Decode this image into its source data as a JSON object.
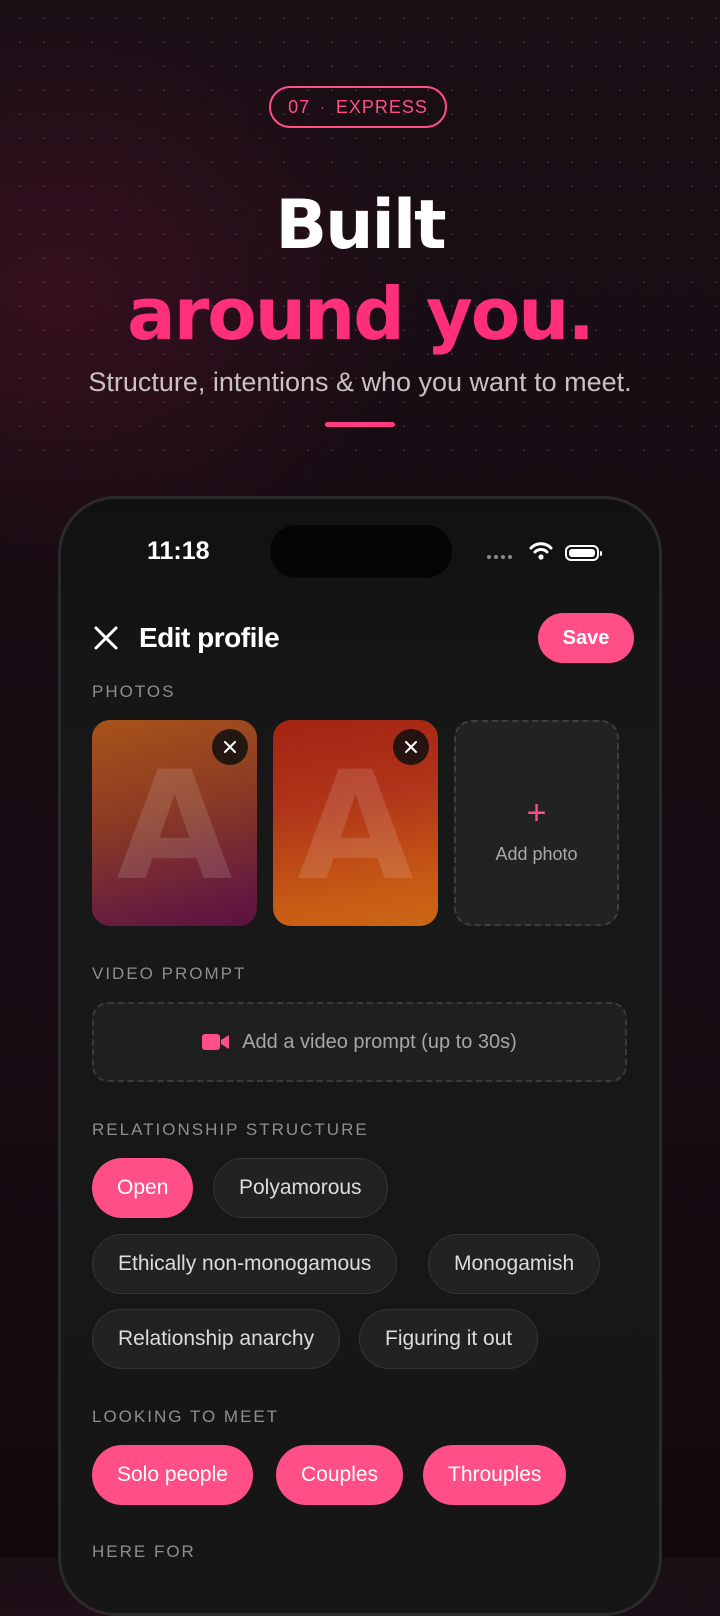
{
  "badge": {
    "number": "07",
    "separator": "·",
    "label": "EXPRESS"
  },
  "headline": {
    "line1": "Built",
    "line2": "around you."
  },
  "subtitle": "Structure, intentions & who you want to meet.",
  "colors": {
    "accent": "#ff4f86",
    "headline_accent": "#ff2f7b",
    "background": "#1a0c14"
  },
  "status_bar": {
    "time": "11:18"
  },
  "edit_profile": {
    "title": "Edit profile",
    "save_label": "Save",
    "photos": {
      "section_label": "PHOTOS",
      "items": [
        {
          "letter": "A"
        },
        {
          "letter": "A"
        }
      ],
      "add_label": "Add photo",
      "add_icon": "+"
    },
    "video_prompt": {
      "section_label": "VIDEO PROMPT",
      "placeholder": "Add a video prompt (up to 30s)"
    },
    "relationship_structure": {
      "section_label": "RELATIONSHIP STRUCTURE",
      "options": [
        {
          "label": "Open",
          "selected": true
        },
        {
          "label": "Polyamorous",
          "selected": false
        },
        {
          "label": "Ethically non-monogamous",
          "selected": false
        },
        {
          "label": "Monogamish",
          "selected": false
        },
        {
          "label": "Relationship anarchy",
          "selected": false
        },
        {
          "label": "Figuring it out",
          "selected": false
        }
      ]
    },
    "looking_to_meet": {
      "section_label": "LOOKING TO MEET",
      "options": [
        {
          "label": "Solo people",
          "selected": true
        },
        {
          "label": "Couples",
          "selected": true
        },
        {
          "label": "Throuples",
          "selected": true
        }
      ]
    },
    "here_for": {
      "section_label": "HERE FOR"
    }
  }
}
